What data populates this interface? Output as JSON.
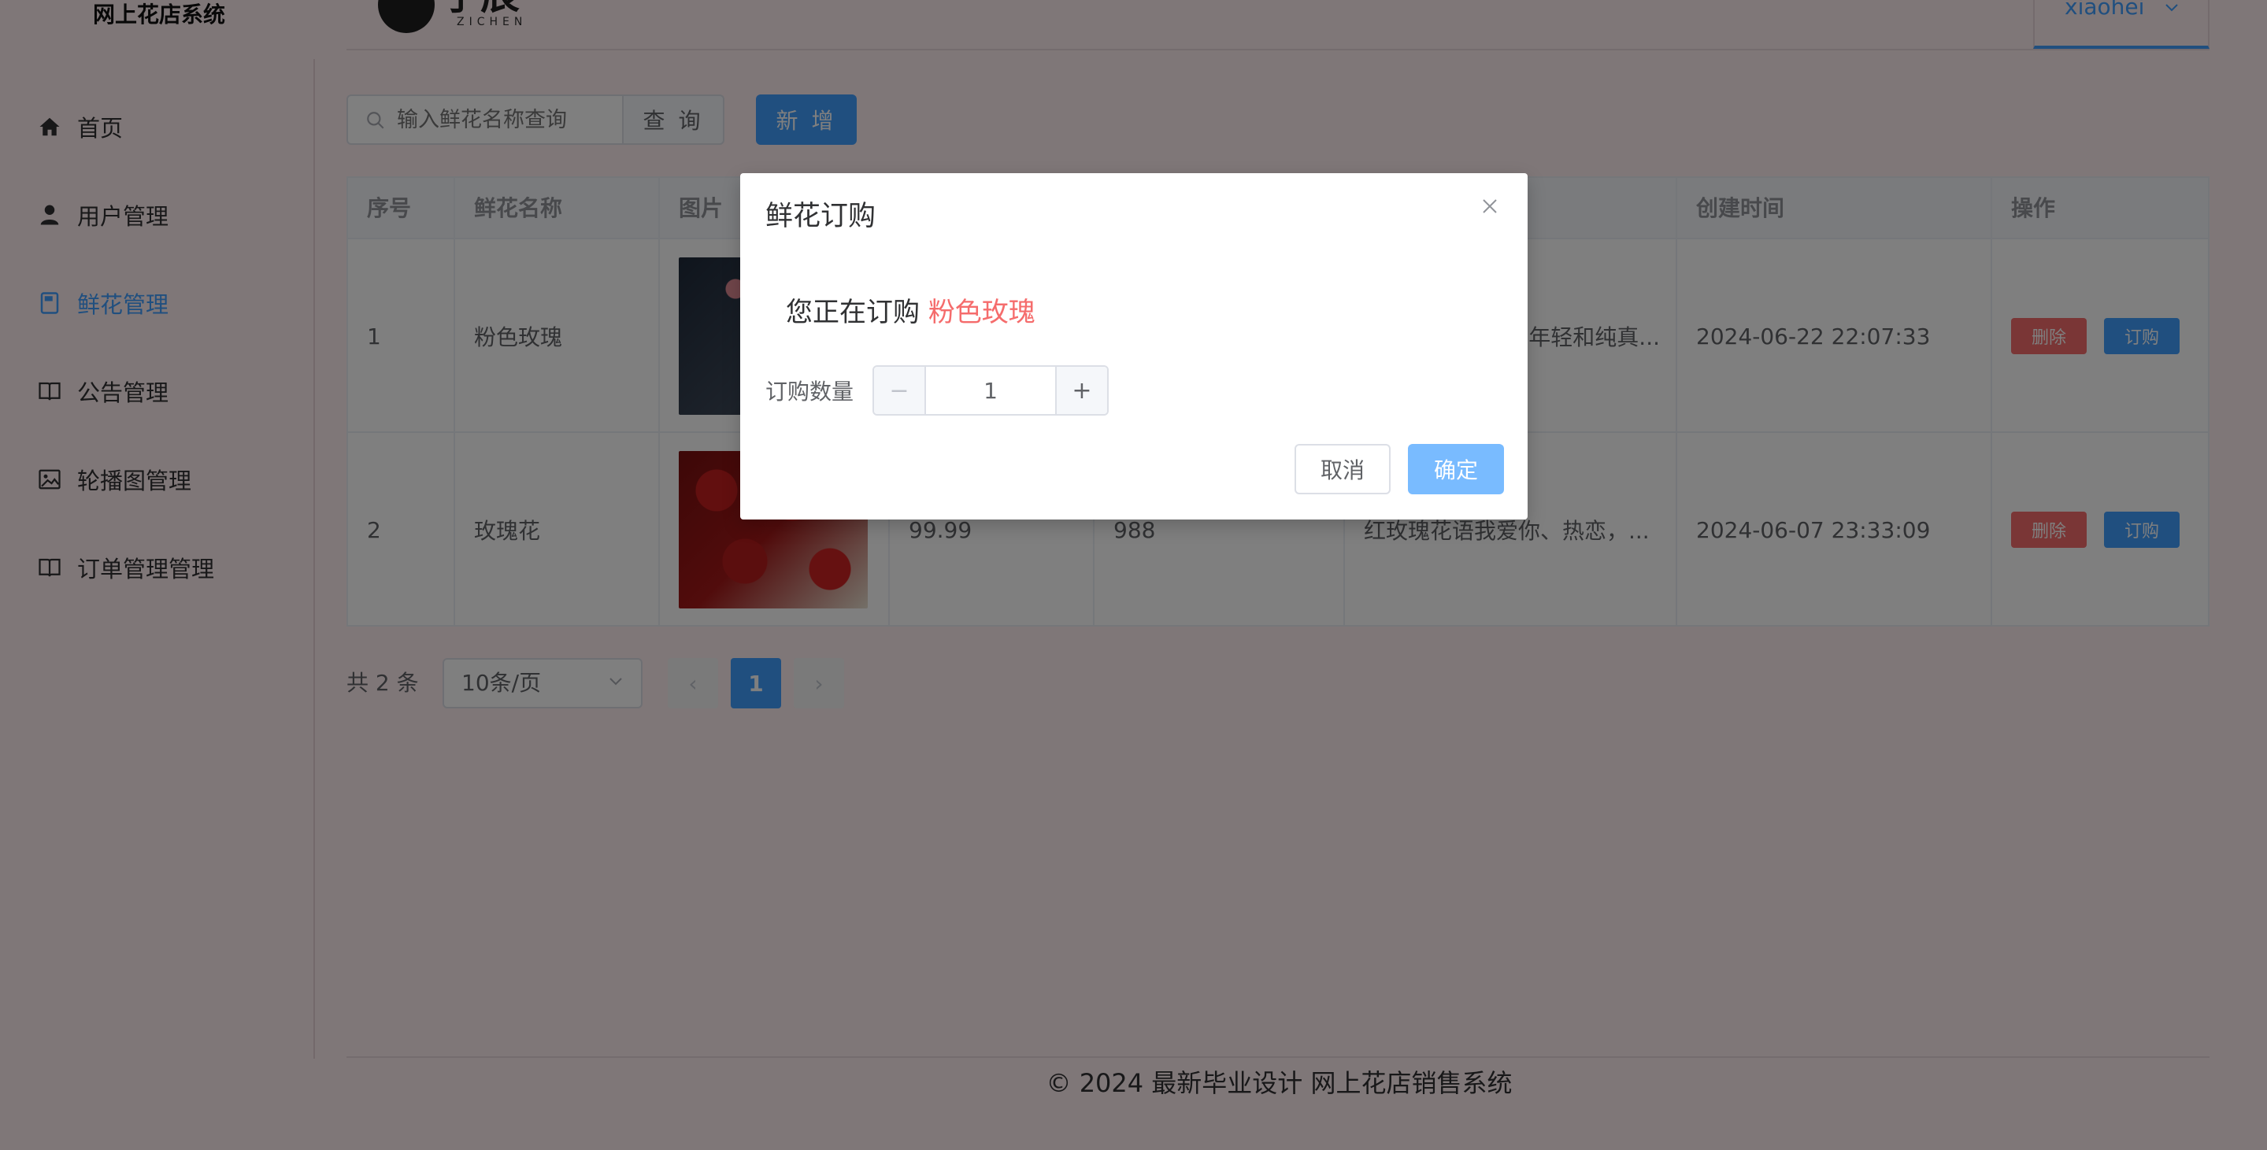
{
  "header": {
    "site_title": "网上花店系统",
    "logo_mark": "子辰",
    "logo_sub": "ZICHEN",
    "user_name": "xiaohei"
  },
  "sidebar": {
    "items": [
      {
        "label": "首页",
        "icon": "home-icon"
      },
      {
        "label": "用户管理",
        "icon": "user-icon"
      },
      {
        "label": "鲜花管理",
        "icon": "notebook-icon",
        "active": true
      },
      {
        "label": "公告管理",
        "icon": "book-icon"
      },
      {
        "label": "轮播图管理",
        "icon": "picture-icon"
      },
      {
        "label": "订单管理管理",
        "icon": "book-icon"
      }
    ]
  },
  "toolbar": {
    "search_placeholder": "输入鲜花名称查询",
    "query_label": "查 询",
    "add_label": "新 增"
  },
  "table": {
    "headers": [
      "序号",
      "鲜花名称",
      "图片",
      "",
      "",
      "",
      "创建时间",
      "操作"
    ],
    "rows": [
      {
        "index": "1",
        "name": "粉色玫瑰",
        "price": "",
        "stock": "",
        "desc": "年轻和纯真...",
        "created": "2024-06-22 22:07:33",
        "del": "删除",
        "buy": "订购"
      },
      {
        "index": "2",
        "name": "玫瑰花",
        "price": "99.99",
        "stock": "988",
        "desc": "红玫瑰花语我爱你、热恋，...",
        "created": "2024-06-07 23:33:09",
        "del": "删除",
        "buy": "订购"
      }
    ]
  },
  "pagination": {
    "total": "共 2 条",
    "page_size": "10条/页",
    "prev": "‹",
    "current": "1",
    "next": "›"
  },
  "footer": {
    "text": "© 2024 最新毕业设计 网上花店销售系统"
  },
  "modal": {
    "title": "鲜花订购",
    "msg_prefix": "您正在订购",
    "msg_flower": "粉色玫瑰",
    "qty_label": "订购数量",
    "qty_value": "1",
    "minus": "−",
    "plus": "+",
    "cancel": "取消",
    "ok": "确定"
  },
  "colors": {
    "primary": "#409eff",
    "danger": "#f56c6c",
    "page_bg": "#ffeef0"
  }
}
